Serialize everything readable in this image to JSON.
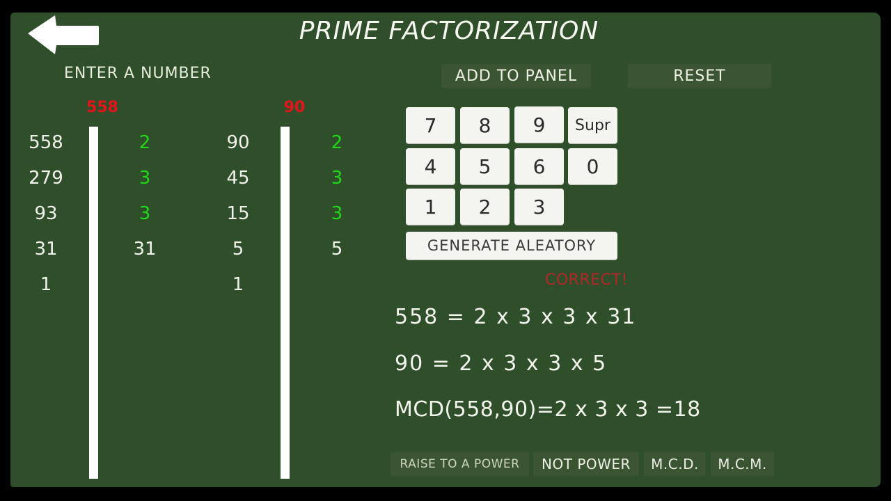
{
  "header": {
    "title": "PRIME FACTORIZATION",
    "back_icon": "arrow-left-icon"
  },
  "input": {
    "label": "ENTER A NUMBER"
  },
  "toolbar": {
    "add_to_panel": "ADD TO PANEL",
    "reset": "RESET"
  },
  "factorizations": [
    {
      "number": "558",
      "dividends": [
        "558",
        "279",
        "93",
        "31",
        "1"
      ],
      "divisors": [
        {
          "value": "2",
          "state": "correct"
        },
        {
          "value": "3",
          "state": "correct"
        },
        {
          "value": "3",
          "state": "correct"
        },
        {
          "value": "31",
          "state": "plain"
        }
      ]
    },
    {
      "number": "90",
      "dividends": [
        "90",
        "45",
        "15",
        "5",
        "1"
      ],
      "divisors": [
        {
          "value": "2",
          "state": "correct"
        },
        {
          "value": "3",
          "state": "correct"
        },
        {
          "value": "3",
          "state": "correct"
        },
        {
          "value": "5",
          "state": "plain"
        }
      ]
    }
  ],
  "keypad": {
    "keys": [
      "7",
      "8",
      "9",
      "Supr",
      "4",
      "5",
      "6",
      "0",
      "1",
      "2",
      "3"
    ],
    "generate": "GENERATE ALEATORY"
  },
  "result": {
    "status": "CORRECT!",
    "lines": [
      "558 = 2 x 3 x 3 x 31",
      "90 = 2 x 3 x 3 x 5",
      "MCD(558,90)=2 x 3 x 3 =18"
    ]
  },
  "modes": {
    "raise_to_power": "RAISE TO A POWER",
    "not_power": "NOT POWER",
    "mcd": "M.C.D.",
    "mcm": "M.C.M."
  },
  "colors": {
    "board": "#2f4f2a",
    "number_header": "#e4141b",
    "correct_divisor": "#22d61c",
    "status_text": "#b3262a"
  }
}
